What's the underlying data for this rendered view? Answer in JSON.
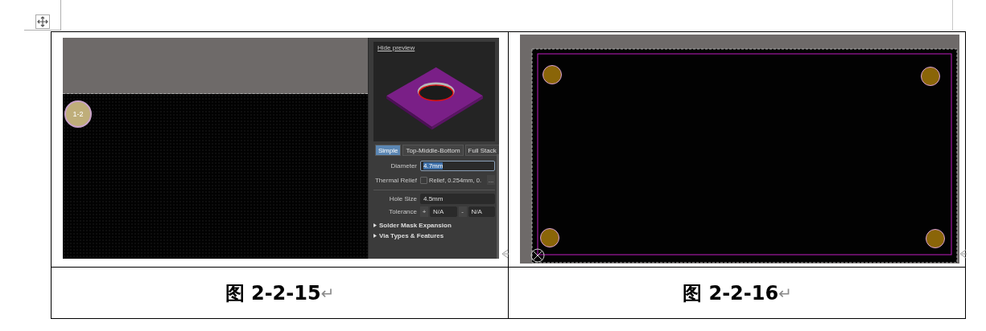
{
  "figures": [
    {
      "kind": "via-editor",
      "pad_label": "1-2",
      "panel": {
        "preview_link": "Hide preview",
        "modes": [
          {
            "label": "Simple",
            "selected": true
          },
          {
            "label": "Top-Middle-Bottom",
            "selected": false
          },
          {
            "label": "Full Stack",
            "selected": false
          }
        ],
        "diameter": {
          "label": "Diameter",
          "value": "4.7mm",
          "text_selected": true
        },
        "thermal_relief": {
          "label": "Thermal Relief",
          "checked": false,
          "value": "Relief, 0.254mm, 0.",
          "button": "..."
        },
        "hole_size": {
          "label": "Hole Size",
          "value": "4.5mm"
        },
        "tolerance": {
          "label": "Tolerance",
          "plus_sign": "+",
          "plus_value": "N/A",
          "minus_sign": "-",
          "minus_value": "N/A"
        },
        "sections": [
          {
            "label": "Solder Mask Expansion",
            "expanded": false
          },
          {
            "label": "Via Types & Features",
            "expanded": false
          }
        ]
      },
      "caption": "图 2-2-15",
      "paragraph_mark": "↵"
    },
    {
      "kind": "board-view",
      "caption": "图 2-2-16",
      "paragraph_mark": "↵"
    }
  ]
}
